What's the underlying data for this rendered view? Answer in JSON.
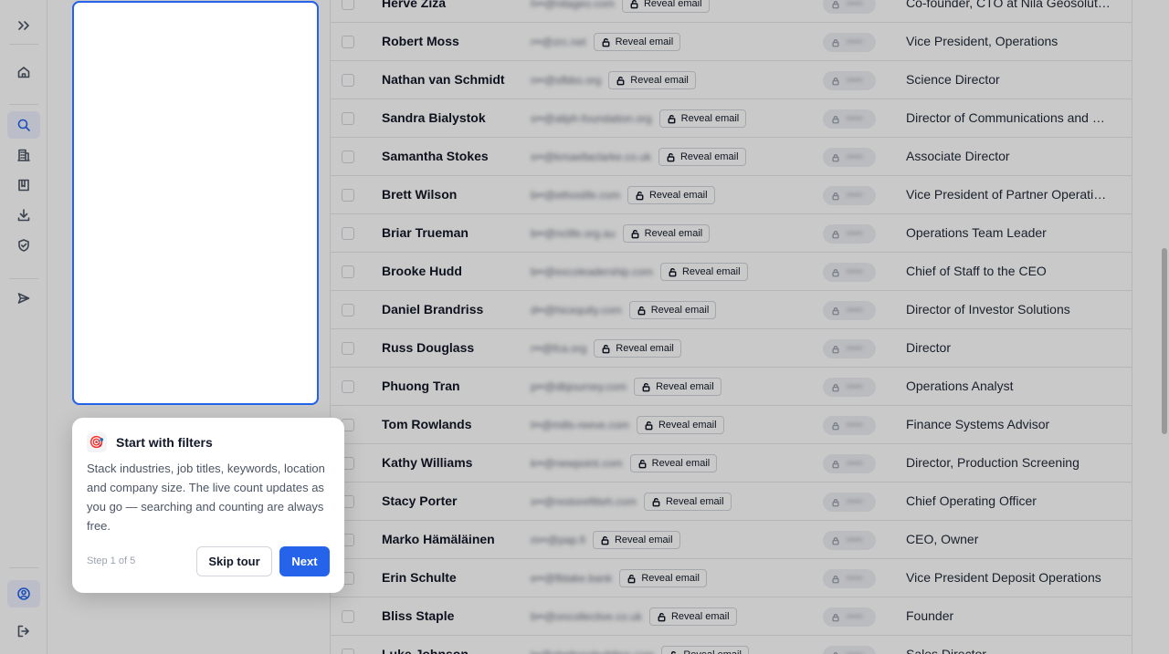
{
  "colors": {
    "accent": "#2563eb",
    "overlay": "rgba(0,0,0,0.21)"
  },
  "sidebar": {
    "items": [
      {
        "icon": "chevrons-right-icon"
      },
      {
        "icon": "home-icon"
      },
      {
        "icon": "search-icon",
        "active": true
      },
      {
        "icon": "building-icon"
      },
      {
        "icon": "book-icon"
      },
      {
        "icon": "download-icon"
      },
      {
        "icon": "shield-check-icon"
      },
      {
        "icon": "send-icon"
      },
      {
        "icon": "user-circle-icon"
      },
      {
        "icon": "logout-icon"
      }
    ]
  },
  "table": {
    "reveal_label": "Reveal email",
    "rows": [
      {
        "name": "Herve Ziza",
        "email_masked": "h••@nilageo.com",
        "title": "Co-founder, CTO at Nila Geosolutions"
      },
      {
        "name": "Robert Moss",
        "email_masked": "r••@zrc.net",
        "title": "Vice President, Operations"
      },
      {
        "name": "Nathan van Schmidt",
        "email_masked": "n••@sfbbo.org",
        "title": "Science Director"
      },
      {
        "name": "Sandra Bialystok",
        "email_masked": "s••@aliph-foundation.org",
        "title": "Director of Communications and Outreach"
      },
      {
        "name": "Samantha Stokes",
        "email_masked": "s••@kmaellaclarke.co.uk",
        "title": "Associate Director"
      },
      {
        "name": "Brett Wilson",
        "email_masked": "b••@ethoslife.com",
        "title": "Vice President of Partner Operations"
      },
      {
        "name": "Briar Trueman",
        "email_masked": "b••@nclife.org.au",
        "title": "Operations Team Leader"
      },
      {
        "name": "Brooke Hudd",
        "email_masked": "b••@excoleadership.com",
        "title": "Chief of Staff to the CEO"
      },
      {
        "name": "Daniel Brandriss",
        "email_masked": "d••@hicequity.com",
        "title": "Director of Investor Solutions"
      },
      {
        "name": "Russ Douglass",
        "email_masked": "r••@fca.org",
        "title": "Director"
      },
      {
        "name": "Phuong Tran",
        "email_masked": "p••@dbjourney.com",
        "title": "Operations Analyst"
      },
      {
        "name": "Tom Rowlands",
        "email_masked": "t••@mills-reeve.com",
        "title": "Finance Systems Advisor"
      },
      {
        "name": "Kathy Williams",
        "email_masked": "k••@newpoint.com",
        "title": "Director, Production Screening"
      },
      {
        "name": "Stacy Porter",
        "email_masked": "s••@restorefitteh.com",
        "title": "Chief Operating Officer"
      },
      {
        "name": "Marko Hämäläinen",
        "email_masked": "m••@pap.fi",
        "title": "CEO, Owner"
      },
      {
        "name": "Erin Schulte",
        "email_masked": "e••@fbtake.bank",
        "title": "Vice President Deposit Operations"
      },
      {
        "name": "Bliss Staple",
        "email_masked": "b••@oncollective.co.uk",
        "title": "Founder"
      },
      {
        "name": "Luke Johnson",
        "email_masked": "l••@sheltonsbuilding.com",
        "title": "Sales Director"
      }
    ]
  },
  "tour": {
    "icon": "target-icon",
    "icon_glyph": "🎯",
    "title": "Start with filters",
    "body": "Stack industries, job titles, keywords, location and company size. The live count updates as you go — searching and counting are always free.",
    "step": "Step 1 of 5",
    "skip_label": "Skip tour",
    "next_label": "Next"
  }
}
